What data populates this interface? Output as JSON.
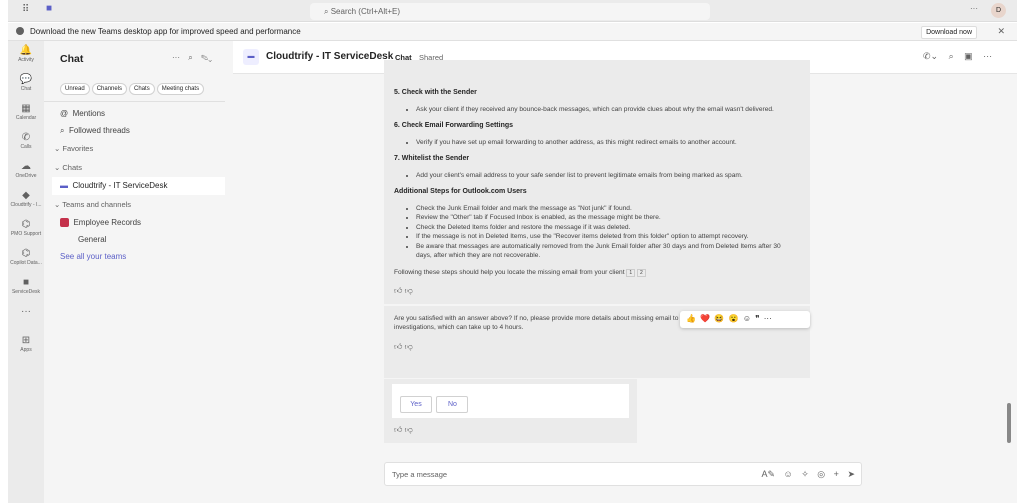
{
  "topbar": {
    "search_placeholder": "Search (Ctrl+Alt+E)",
    "avatar_initial": "D",
    "more": "···"
  },
  "banner": {
    "text": "Download the new Teams desktop app for improved speed and performance",
    "download_label": "Download now",
    "close": "✕"
  },
  "rail": [
    {
      "label": "Activity",
      "icon": "🔔"
    },
    {
      "label": "Chat",
      "icon": "💬"
    },
    {
      "label": "Calendar",
      "icon": "▦"
    },
    {
      "label": "Calls",
      "icon": "✆"
    },
    {
      "label": "OneDrive",
      "icon": "☁"
    },
    {
      "label": "Cloudtrify - I...",
      "icon": "◆"
    },
    {
      "label": "PMO Support",
      "icon": "⌬"
    },
    {
      "label": "Copilot Data...",
      "icon": "⌬"
    },
    {
      "label": "ServiceDesk",
      "icon": "■"
    },
    {
      "label": "",
      "icon": "···"
    },
    {
      "label": "Apps",
      "icon": "⊞"
    }
  ],
  "chatlist": {
    "title": "Chat",
    "filters": [
      "Unread",
      "Channels",
      "Chats",
      "Meeting chats"
    ],
    "mentions": "Mentions",
    "followed": "Followed threads",
    "favorites": "Favorites",
    "chats_header": "Chats",
    "chat_item": "Cloudtrify - IT ServiceDesk",
    "teams_header": "Teams and channels",
    "team": "Employee Records",
    "channel": "General",
    "see_all": "See all your teams"
  },
  "header": {
    "title": "Cloudtrify - IT ServiceDesk",
    "tab_chat": "Chat",
    "tab_shared": "Shared"
  },
  "message": {
    "s5_title": "5. Check with the Sender",
    "s5_items": [
      "Ask your client if they received any bounce-back messages, which can provide clues about why the email wasn't delivered."
    ],
    "s6_title": "6. Check Email Forwarding Settings",
    "s6_items": [
      "Verify if you have set up email forwarding to another address, as this might redirect emails to another account."
    ],
    "s7_title": "7. Whitelist the Sender",
    "s7_items": [
      "Add your client's email address to your safe sender list to prevent legitimate emails from being marked as spam."
    ],
    "add_title": "Additional Steps for Outlook.com Users",
    "add_items": [
      "Check the Junk Email folder and mark the message as \"Not junk\" if found.",
      "Review the \"Other\" tab if Focused Inbox is enabled, as the message might be there.",
      "Check the Deleted Items folder and restore the message if it was deleted.",
      "If the message is not in Deleted Items, use the \"Recover items deleted from this folder\" option to attempt recovery.",
      "Be aware that messages are automatically removed from the Junk Email folder after 30 days and from Deleted Items after 30 days, after which they are not recoverable."
    ],
    "conclusion": "Following these steps should help you locate the missing email from your client",
    "cite1": "1",
    "cite2": "2",
    "question": "Are you satisfied with an answer above? If no, please provide more details about missing email to submit a ticket for further automated investigations, which can take up to 4 hours."
  },
  "reactions": [
    "👍",
    "❤️",
    "😆",
    "😮",
    "☺",
    "❞",
    "···"
  ],
  "card": {
    "yes": "Yes",
    "no": "No"
  },
  "compose": {
    "placeholder": "Type a message",
    "icons": [
      "A✎",
      "☺",
      "✧",
      "◎",
      "+",
      "➤"
    ]
  }
}
